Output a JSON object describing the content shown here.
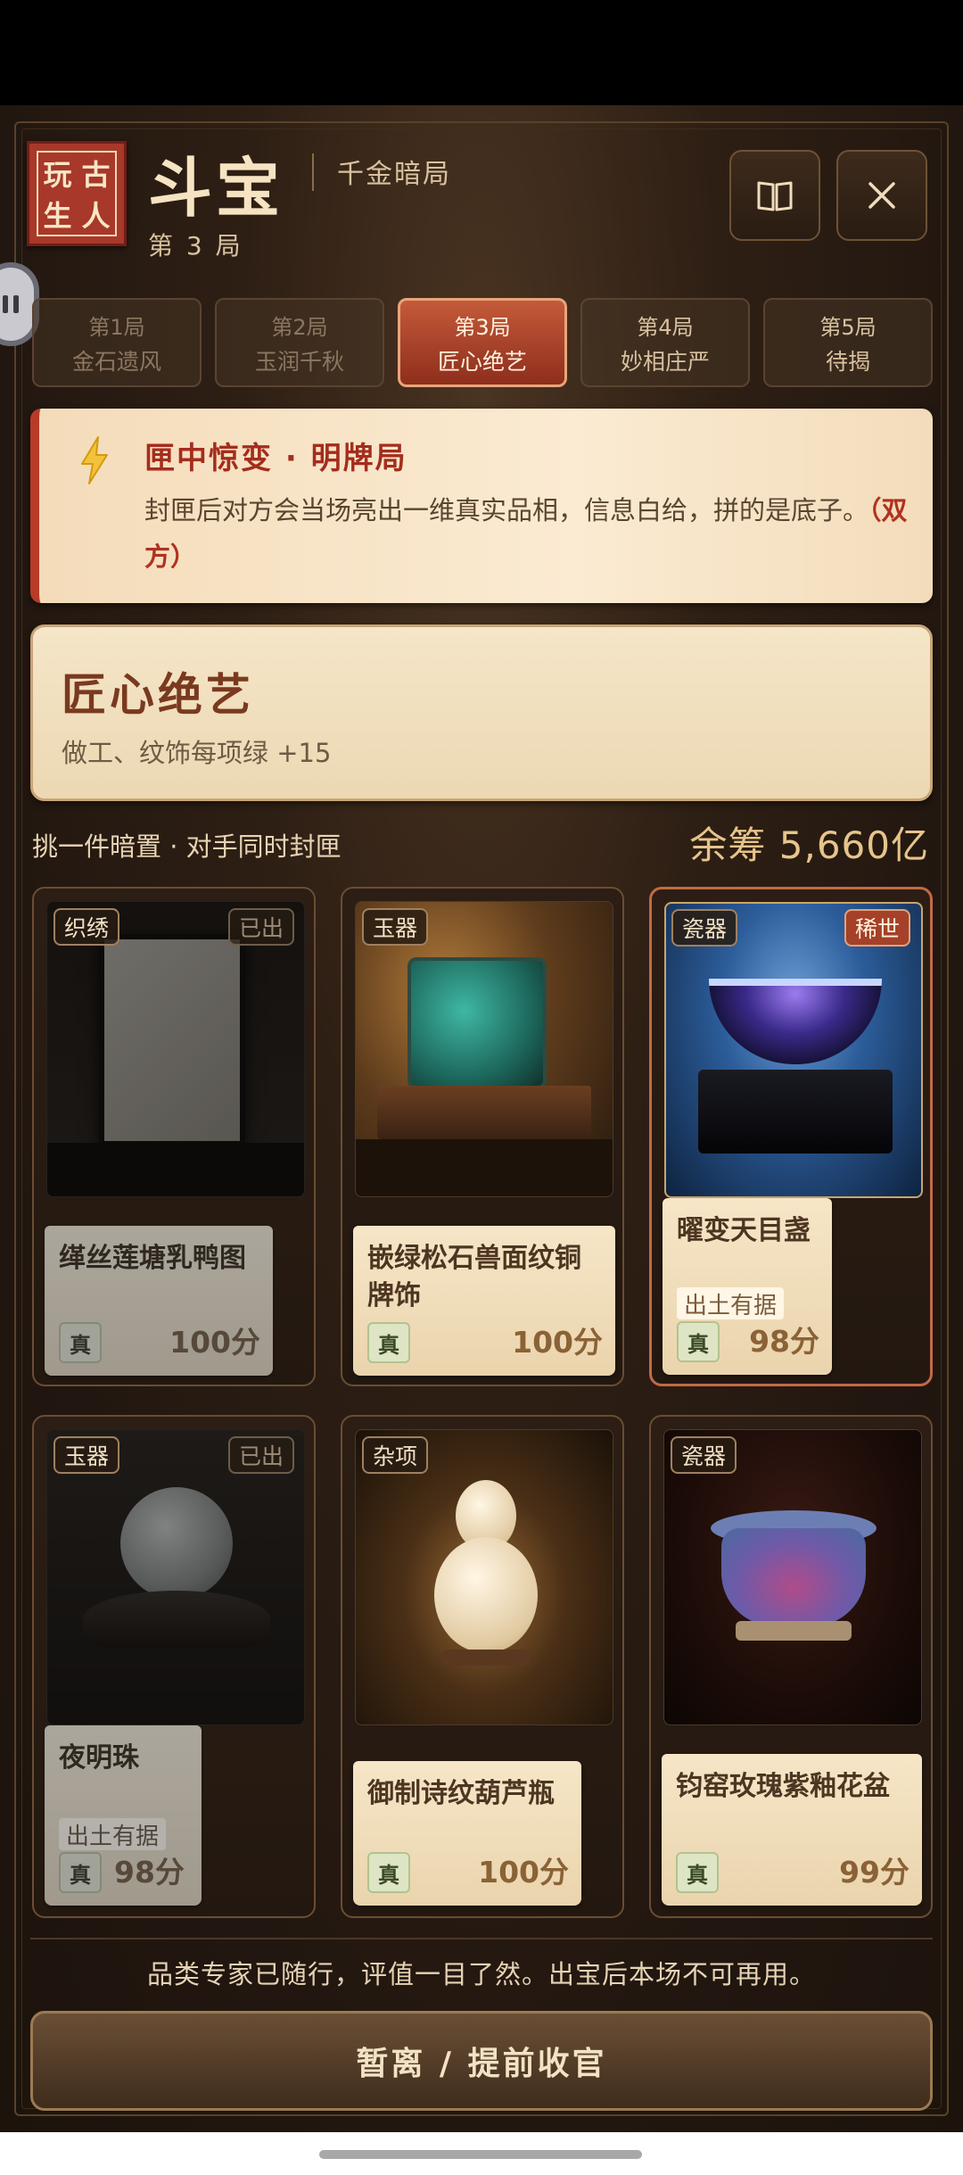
{
  "header": {
    "seal_chars": [
      "古",
      "玩",
      "人",
      "生"
    ],
    "title": "斗宝",
    "subtitle": "千金暗局",
    "round_label": "第 3 局"
  },
  "tabs": [
    {
      "round": "第1局",
      "name": "金石遗风",
      "state": "done"
    },
    {
      "round": "第2局",
      "name": "玉润千秋",
      "state": "done"
    },
    {
      "round": "第3局",
      "name": "匠心绝艺",
      "state": "active"
    },
    {
      "round": "第4局",
      "name": "妙相庄严",
      "state": "upcoming"
    },
    {
      "round": "第5局",
      "name": "待揭",
      "state": "upcoming"
    }
  ],
  "event": {
    "title": "匣中惊变 · 明牌局",
    "desc": "封匣后对方会当场亮出一维真实品相，信息白给，拼的是底子。",
    "highlight": "（双方）"
  },
  "skill": {
    "title": "匠心绝艺",
    "desc": "做工、纹饰每项绿 +15"
  },
  "instruction": "挑一件暗置 · 对手同时封匣",
  "chips": "余筹 5,660亿",
  "items": [
    {
      "category": "织绣",
      "status": "已出",
      "name": "缂丝莲塘乳鸭图",
      "provenance": "",
      "auth": "真",
      "score": "100分",
      "used": true
    },
    {
      "category": "玉器",
      "status": "",
      "name": "嵌绿松石兽面纹铜牌饰",
      "provenance": "",
      "auth": "真",
      "score": "100分",
      "used": false
    },
    {
      "category": "瓷器",
      "status": "稀世",
      "name": "曜变天目盏",
      "provenance": "出土有据",
      "auth": "真",
      "score": "98分",
      "used": false
    },
    {
      "category": "玉器",
      "status": "已出",
      "name": "夜明珠",
      "provenance": "出土有据",
      "auth": "真",
      "score": "98分",
      "used": true
    },
    {
      "category": "杂项",
      "status": "",
      "name": "御制诗纹葫芦瓶",
      "provenance": "",
      "auth": "真",
      "score": "100分",
      "used": false
    },
    {
      "category": "瓷器",
      "status": "",
      "name": "钧窑玫瑰紫釉花盆",
      "provenance": "",
      "auth": "真",
      "score": "99分",
      "used": false
    }
  ],
  "footer": {
    "note": "品类专家已随行，评值一目了然。出宝后本场不可再用。",
    "retreat_label": "暂离 / 提前收官"
  }
}
